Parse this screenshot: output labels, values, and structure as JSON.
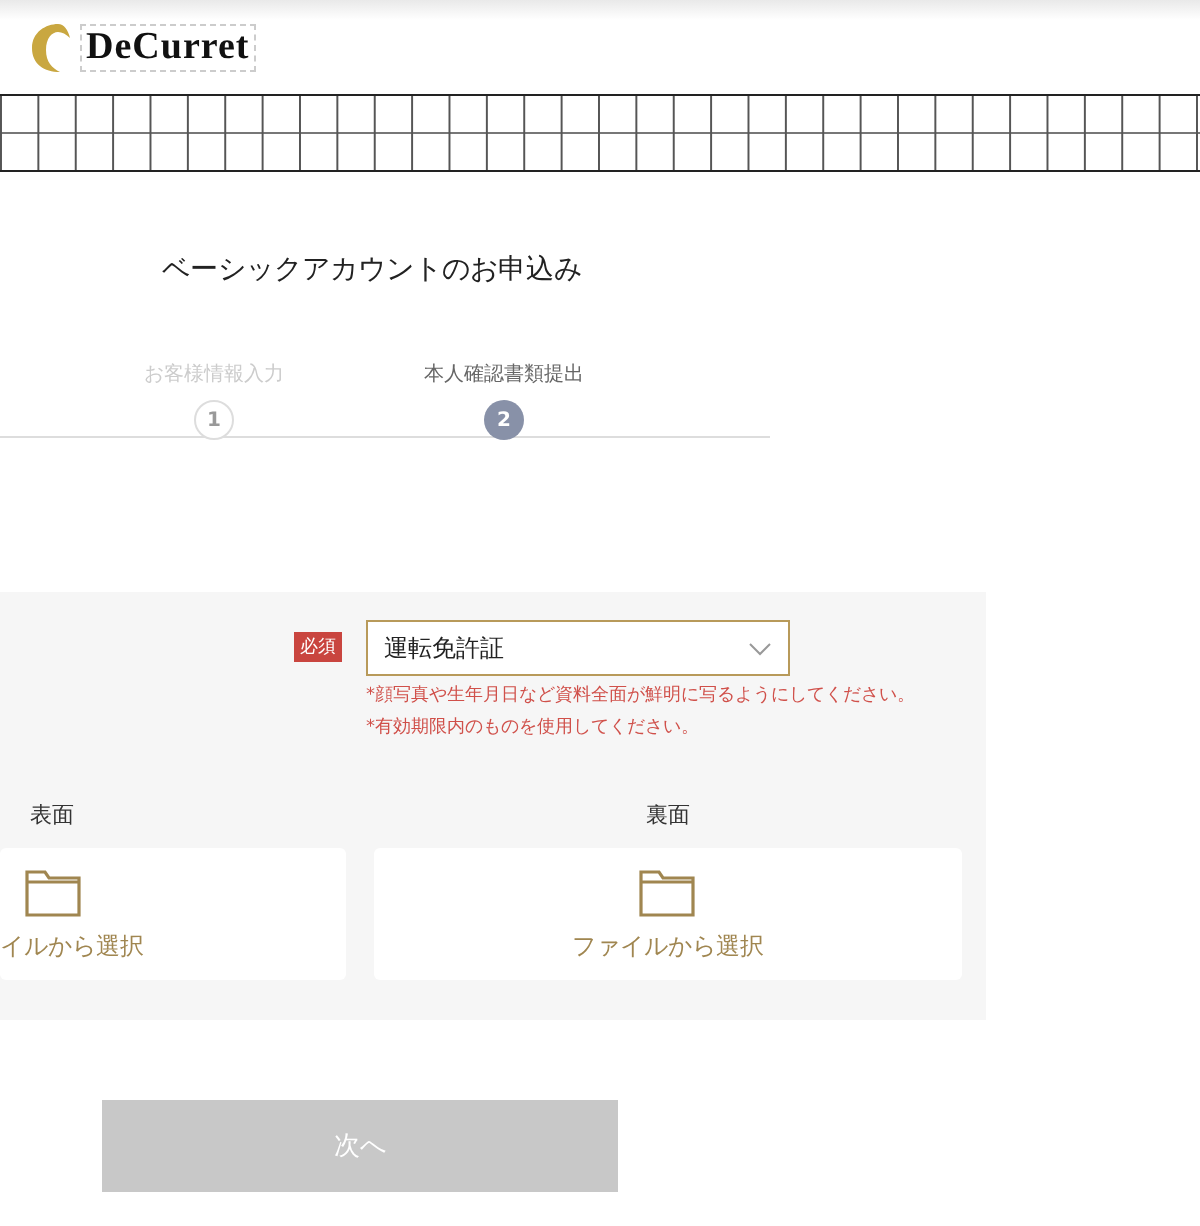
{
  "header": {
    "logo_text": "DeCurret"
  },
  "title": "ベーシックアカウントのお申込み",
  "steps": [
    {
      "label": "お客様情報入力",
      "number": "1",
      "selected": false
    },
    {
      "label": "本人確認書類提出",
      "number": "2",
      "selected": true
    }
  ],
  "document": {
    "required_badge": "必須",
    "select_value": "運転免許証",
    "notes": [
      "*顔写真や生年月日など資料全面が鮮明に写るようにしてください。",
      "*有効期限内のものを使用してください。"
    ]
  },
  "uploads": [
    {
      "label": "表面",
      "button": "イルから選択"
    },
    {
      "label": "裏面",
      "button": "ファイルから選択"
    }
  ],
  "next_button": {
    "label": "次へ",
    "disabled": true
  }
}
